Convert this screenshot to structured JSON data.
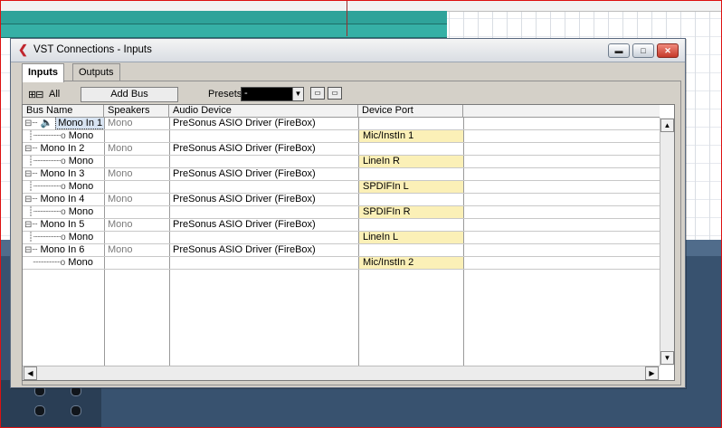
{
  "window": {
    "title": "VST Connections - Inputs",
    "buttons": {
      "minimize": "▬",
      "maximize": "□",
      "close": "✕"
    }
  },
  "tabs": [
    {
      "label": "Inputs",
      "active": true
    },
    {
      "label": "Outputs",
      "active": false
    }
  ],
  "toolbar": {
    "all_label": "All",
    "add_bus_label": "Add Bus",
    "presets_label": "Presets",
    "presets_value": "-"
  },
  "table": {
    "headers": [
      "Bus Name",
      "Speakers",
      "Audio Device",
      "Device Port"
    ],
    "rows": [
      {
        "bus": "Mono In 1",
        "speakers": "Mono",
        "device": "PreSonus ASIO Driver (FireBox)",
        "sub_label": "Mono",
        "port": "Mic/InstIn 1"
      },
      {
        "bus": "Mono In 2",
        "speakers": "Mono",
        "device": "PreSonus ASIO Driver (FireBox)",
        "sub_label": "Mono",
        "port": "LineIn R"
      },
      {
        "bus": "Mono In 3",
        "speakers": "Mono",
        "device": "PreSonus ASIO Driver (FireBox)",
        "sub_label": "Mono",
        "port": "SPDIFIn L"
      },
      {
        "bus": "Mono In 4",
        "speakers": "Mono",
        "device": "PreSonus ASIO Driver (FireBox)",
        "sub_label": "Mono",
        "port": "SPDIFIn R"
      },
      {
        "bus": "Mono In 5",
        "speakers": "Mono",
        "device": "PreSonus ASIO Driver (FireBox)",
        "sub_label": "Mono",
        "port": "LineIn L"
      },
      {
        "bus": "Mono In 6",
        "speakers": "Mono",
        "device": "PreSonus ASIO Driver (FireBox)",
        "sub_label": "Mono",
        "port": "Mic/InstIn 2"
      }
    ]
  },
  "colors": {
    "port_highlight": "#fbf0b7",
    "track_teal": "#2fa39a",
    "app_icon_red": "#c0262d"
  },
  "icons": [
    "app-logo-icon",
    "speaker-icon",
    "expand-all-icon",
    "collapse-all-icon",
    "preset-save-icon",
    "preset-load-icon"
  ]
}
